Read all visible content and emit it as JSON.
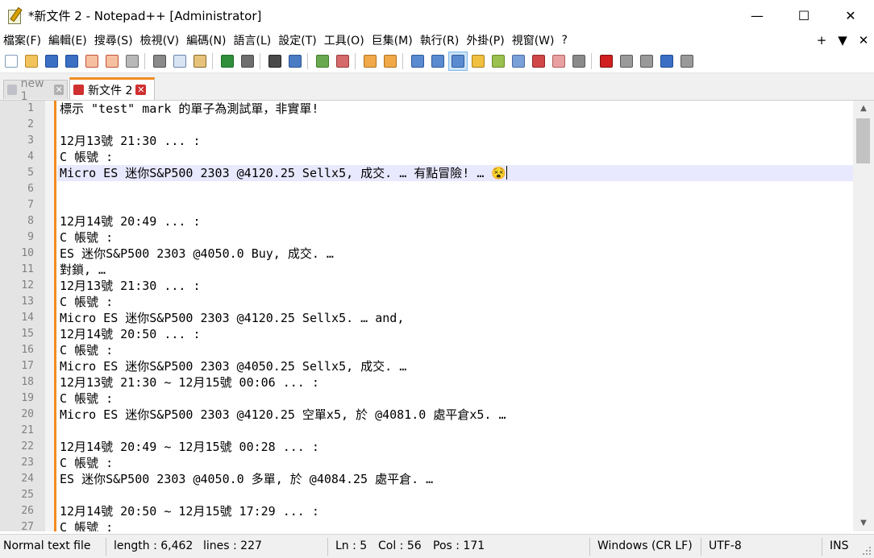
{
  "window": {
    "title": "*新文件 2 - Notepad++ [Administrator]",
    "minimize": "—",
    "maximize": "☐",
    "close": "✕"
  },
  "menu": {
    "items": [
      "檔案(F)",
      "編輯(E)",
      "搜尋(S)",
      "檢視(V)",
      "編碼(N)",
      "語言(L)",
      "設定(T)",
      "工具(O)",
      "巨集(M)",
      "執行(R)",
      "外掛(P)",
      "視窗(W)",
      "?"
    ],
    "right": [
      "+",
      "▼",
      "✕"
    ]
  },
  "toolbar": {
    "icons": [
      {
        "name": "new-file-icon",
        "color": "#ffffff",
        "border": "#7f9db9"
      },
      {
        "name": "open-folder-icon",
        "color": "#f2c35b",
        "border": "#b78a2a"
      },
      {
        "name": "save-icon",
        "color": "#3a6fc4",
        "border": "#1e4c96"
      },
      {
        "name": "save-all-icon",
        "color": "#3a6fc4",
        "border": "#1e4c96"
      },
      {
        "name": "close-icon",
        "color": "#f6c0a0",
        "border": "#c0503a"
      },
      {
        "name": "close-all-icon",
        "color": "#f6c0a0",
        "border": "#c0503a"
      },
      {
        "name": "print-icon",
        "color": "#b8b8b8",
        "border": "#6f6f6f"
      },
      "sep",
      {
        "name": "cut-icon",
        "color": "#8a8a8a",
        "border": "#505050"
      },
      {
        "name": "copy-icon",
        "color": "#d9e4f3",
        "border": "#6a84ac"
      },
      {
        "name": "paste-icon",
        "color": "#e6c27a",
        "border": "#8a6a2a"
      },
      "sep",
      {
        "name": "undo-icon",
        "color": "#2f8f3a",
        "border": "#1d6a27"
      },
      {
        "name": "redo-icon",
        "color": "#6e6e6e",
        "border": "#4a4a4a"
      },
      "sep",
      {
        "name": "find-icon",
        "color": "#4a4a4a",
        "border": "#222222"
      },
      {
        "name": "replace-icon",
        "color": "#4a7cc4",
        "border": "#2b5592"
      },
      "sep",
      {
        "name": "zoom-in-icon",
        "color": "#6aa84f",
        "border": "#3f7a2a"
      },
      {
        "name": "zoom-out-icon",
        "color": "#d46a6a",
        "border": "#9a3a3a"
      },
      "sep",
      {
        "name": "sync-vertical-icon",
        "color": "#f0a848",
        "border": "#b07020"
      },
      {
        "name": "sync-horizontal-icon",
        "color": "#f0a848",
        "border": "#b07020"
      },
      "sep",
      {
        "name": "word-wrap-icon",
        "color": "#5a8ad0",
        "border": "#2e5a9a"
      },
      {
        "name": "show-all-chars-icon",
        "color": "#5a8ad0",
        "border": "#2e5a9a"
      },
      {
        "name": "indent-guide-icon",
        "color": "#5a8ad0",
        "border": "#2e5a9a",
        "selected": true
      },
      {
        "name": "user-language-icon",
        "color": "#f0c040",
        "border": "#a88018"
      },
      {
        "name": "doc-map-icon",
        "color": "#9ac050",
        "border": "#6a8a28"
      },
      {
        "name": "doc-list-icon",
        "color": "#7aa0d8",
        "border": "#4a6aa0"
      },
      {
        "name": "function-list-icon",
        "color": "#d04848",
        "border": "#902828"
      },
      {
        "name": "folder-workspace-icon",
        "color": "#e8a0a0",
        "border": "#b06060"
      },
      {
        "name": "monitoring-icon",
        "color": "#8a8a8a",
        "border": "#5a5a5a"
      },
      "sep",
      {
        "name": "record-macro-icon",
        "color": "#d02020",
        "border": "#801010"
      },
      {
        "name": "stop-record-icon",
        "color": "#9a9a9a",
        "border": "#5a5a5a"
      },
      {
        "name": "play-macro-icon",
        "color": "#9a9a9a",
        "border": "#5a5a5a"
      },
      {
        "name": "run-macro-multiple-icon",
        "color": "#3a6fc4",
        "border": "#1e4c96"
      },
      {
        "name": "save-macro-icon",
        "color": "#9a9a9a",
        "border": "#5a5a5a"
      }
    ]
  },
  "tabs": [
    {
      "label": "new 1",
      "active": false,
      "save_color": "#c0c0c8",
      "close_color": "#b0b0b0"
    },
    {
      "label": "新文件 2",
      "active": true,
      "save_color": "#d03030",
      "close_color": "#d03030"
    }
  ],
  "editor": {
    "current_line": 5,
    "lines": [
      {
        "n": "1",
        "text": "標示 \"test\" mark 的單子為測試單，非實單!"
      },
      {
        "n": "2",
        "text": ""
      },
      {
        "n": "3",
        "text": "12月13號 21:30 ... :"
      },
      {
        "n": "4",
        "text": "C 帳號 :"
      },
      {
        "n": "5",
        "text": "Micro ES 迷你S&P500 2303 @4120.25 Sellx5, 成交. … 有點冒險! … 😵"
      },
      {
        "n": "6",
        "text": ""
      },
      {
        "n": "7",
        "text": ""
      },
      {
        "n": "8",
        "text": "12月14號 20:49 ... :"
      },
      {
        "n": "9",
        "text": "C 帳號 :"
      },
      {
        "n": "10",
        "text": "ES 迷你S&P500 2303 @4050.0 Buy, 成交. …"
      },
      {
        "n": "11",
        "text": "對鎖, …"
      },
      {
        "n": "12",
        "text": "12月13號 21:30 ... :"
      },
      {
        "n": "13",
        "text": "C 帳號 :"
      },
      {
        "n": "14",
        "text": "Micro ES 迷你S&P500 2303 @4120.25 Sellx5. … and,"
      },
      {
        "n": "15",
        "text": "12月14號 20:50 ... :"
      },
      {
        "n": "16",
        "text": "C 帳號 :"
      },
      {
        "n": "17",
        "text": "Micro ES 迷你S&P500 2303 @4050.25 Sellx5, 成交. …"
      },
      {
        "n": "18",
        "text": "12月13號 21:30 ~ 12月15號 00:06 ... :"
      },
      {
        "n": "19",
        "text": "C 帳號 :"
      },
      {
        "n": "20",
        "text": "Micro ES 迷你S&P500 2303 @4120.25 空單x5, 於 @4081.0 處平倉x5. …"
      },
      {
        "n": "21",
        "text": ""
      },
      {
        "n": "22",
        "text": "12月14號 20:49 ~ 12月15號 00:28 ... :"
      },
      {
        "n": "23",
        "text": "C 帳號 :"
      },
      {
        "n": "24",
        "text": "ES 迷你S&P500 2303 @4050.0 多單, 於 @4084.25 處平倉. …"
      },
      {
        "n": "25",
        "text": ""
      },
      {
        "n": "26",
        "text": "12月14號 20:50 ~ 12月15號 17:29 ... :"
      },
      {
        "n": "27",
        "text": "C 帳號 :"
      }
    ]
  },
  "scrollbar": {
    "up": "▲",
    "down": "▼"
  },
  "status": {
    "file_type": "Normal text file",
    "length": "length : 6,462",
    "lines": "lines : 227",
    "ln": "Ln : 5",
    "col": "Col : 56",
    "pos": "Pos : 171",
    "eol": "Windows (CR LF)",
    "encoding": "UTF-8",
    "mode": "INS"
  },
  "colors": {
    "tab_accent": "#f28b20",
    "current_line_bg": "#e8e8ff",
    "gutter_bg": "#e4e4e4"
  }
}
